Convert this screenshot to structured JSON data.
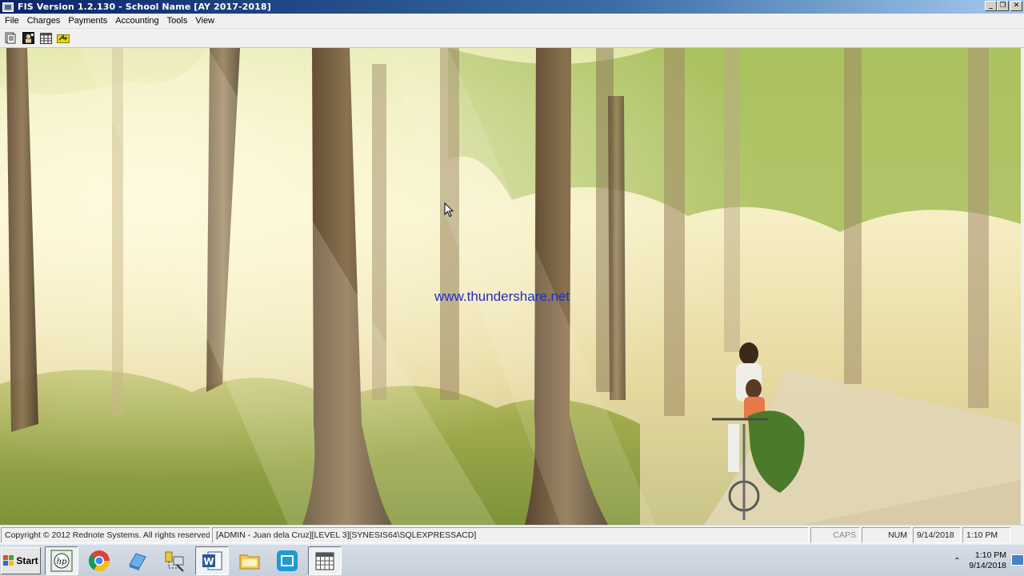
{
  "window": {
    "title": "FIS Version 1.2.130 - School Name [AY 2017-2018]",
    "minimize_label": "_",
    "restore_label": "❐",
    "close_label": "✕"
  },
  "menu": {
    "items": [
      {
        "label": "File"
      },
      {
        "label": "Charges"
      },
      {
        "label": "Payments"
      },
      {
        "label": "Accounting"
      },
      {
        "label": "Tools"
      },
      {
        "label": "View"
      }
    ]
  },
  "toolbar": {
    "buttons": [
      {
        "icon": "document-list-icon"
      },
      {
        "icon": "student-profile-icon"
      },
      {
        "icon": "table-grid-icon"
      },
      {
        "icon": "sync-arrows-icon"
      }
    ]
  },
  "main": {
    "watermark": "www.thundershare.net"
  },
  "statusbar": {
    "copyright": "Copyright © 2012 Rednote Systems. All rights reserved.",
    "user_info": "[ADMIN - Juan dela Cruz][LEVEL 3][SYNESIS64\\SQLEXPRESSACD]",
    "caps": "CAPS",
    "num": "NUM",
    "date": "9/14/2018",
    "time": "1:10 PM"
  },
  "taskbar": {
    "start_label": "Start",
    "apps": [
      {
        "icon": "hp-icon"
      },
      {
        "icon": "chrome-icon"
      },
      {
        "icon": "eraser-app-icon"
      },
      {
        "icon": "network-tools-icon"
      },
      {
        "icon": "word-icon"
      },
      {
        "icon": "file-explorer-icon"
      },
      {
        "icon": "screen-capture-icon"
      },
      {
        "icon": "calendar-app-icon"
      }
    ],
    "tray": {
      "time": "1:10 PM",
      "date": "9/14/2018"
    }
  }
}
